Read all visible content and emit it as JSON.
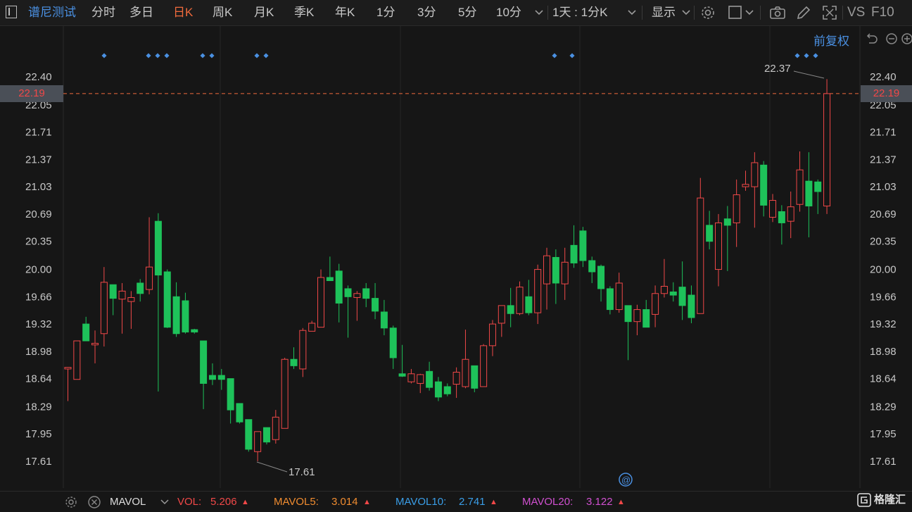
{
  "toolbar": {
    "stock_name": "谱尼测试",
    "tabs": [
      "分时",
      "多日",
      "日K",
      "周K",
      "月K",
      "季K",
      "年K",
      "1分",
      "3分",
      "5分",
      "10分"
    ],
    "active_tab": "日K",
    "period_select": "1天 : 1分K",
    "display_label": "显示",
    "vs_label": "VS",
    "f10_label": "F10"
  },
  "chart": {
    "adjust_label": "前复权",
    "y_ticks": [
      "22.40",
      "22.05",
      "21.71",
      "21.37",
      "21.03",
      "20.69",
      "20.35",
      "20.00",
      "19.66",
      "19.32",
      "18.98",
      "18.64",
      "18.29",
      "17.95",
      "17.61"
    ],
    "current_price": "22.19",
    "high_label": "22.37",
    "low_label": "17.61",
    "colors": {
      "up": "#f04848",
      "down": "#1ec25a",
      "bg": "#161616",
      "grid": "#2a2a2a",
      "marker": "#4a90e2"
    }
  },
  "chart_data": {
    "type": "candlestick",
    "ylim": [
      17.4,
      22.6
    ],
    "candles": [
      {
        "o": 18.76,
        "c": 18.78,
        "h": 18.78,
        "l": 18.36
      },
      {
        "o": 18.63,
        "c": 19.11,
        "h": 19.11,
        "l": 18.63
      },
      {
        "o": 19.32,
        "c": 19.11,
        "h": 19.41,
        "l": 19.11
      },
      {
        "o": 19.06,
        "c": 19.08,
        "h": 19.24,
        "l": 18.83
      },
      {
        "o": 19.2,
        "c": 19.84,
        "h": 20.03,
        "l": 19.04
      },
      {
        "o": 19.81,
        "c": 19.64,
        "h": 19.81,
        "l": 19.43
      },
      {
        "o": 19.63,
        "c": 19.73,
        "h": 19.83,
        "l": 19.2
      },
      {
        "o": 19.6,
        "c": 19.65,
        "h": 19.73,
        "l": 19.26
      },
      {
        "o": 19.83,
        "c": 19.7,
        "h": 19.88,
        "l": 19.6
      },
      {
        "o": 19.75,
        "c": 20.03,
        "h": 20.65,
        "l": 19.69
      },
      {
        "o": 20.6,
        "c": 19.93,
        "h": 20.7,
        "l": 18.48
      },
      {
        "o": 19.97,
        "c": 19.28,
        "h": 20.0,
        "l": 19.27
      },
      {
        "o": 19.66,
        "c": 19.2,
        "h": 19.84,
        "l": 19.16
      },
      {
        "o": 19.61,
        "c": 19.22,
        "h": 19.71,
        "l": 19.2
      },
      {
        "o": 19.25,
        "c": 19.22,
        "h": 19.26,
        "l": 19.2
      },
      {
        "o": 19.11,
        "c": 18.58,
        "h": 19.11,
        "l": 18.26
      },
      {
        "o": 18.68,
        "c": 18.63,
        "h": 18.83,
        "l": 18.56
      },
      {
        "o": 18.68,
        "c": 18.63,
        "h": 18.76,
        "l": 18.5
      },
      {
        "o": 18.64,
        "c": 18.25,
        "h": 18.64,
        "l": 18.08
      },
      {
        "o": 18.33,
        "c": 18.1,
        "h": 18.33,
        "l": 18.08
      },
      {
        "o": 18.13,
        "c": 17.76,
        "h": 18.13,
        "l": 17.73
      },
      {
        "o": 17.73,
        "c": 17.98,
        "h": 17.98,
        "l": 17.61
      },
      {
        "o": 18.03,
        "c": 17.85,
        "h": 18.03,
        "l": 17.82
      },
      {
        "o": 17.88,
        "c": 18.16,
        "h": 18.25,
        "l": 17.83
      },
      {
        "o": 18.02,
        "c": 18.88,
        "h": 18.9,
        "l": 18.02
      },
      {
        "o": 18.88,
        "c": 18.8,
        "h": 19.03,
        "l": 18.76
      },
      {
        "o": 18.76,
        "c": 19.24,
        "h": 19.27,
        "l": 18.66
      },
      {
        "o": 19.23,
        "c": 19.33,
        "h": 19.36,
        "l": 19.24
      },
      {
        "o": 19.28,
        "c": 19.9,
        "h": 20.0,
        "l": 19.28
      },
      {
        "o": 19.9,
        "c": 19.86,
        "h": 20.16,
        "l": 19.86
      },
      {
        "o": 19.98,
        "c": 19.58,
        "h": 20.07,
        "l": 19.34
      },
      {
        "o": 19.76,
        "c": 19.66,
        "h": 19.8,
        "l": 19.15
      },
      {
        "o": 19.65,
        "c": 19.7,
        "h": 19.73,
        "l": 19.36
      },
      {
        "o": 19.76,
        "c": 19.64,
        "h": 19.83,
        "l": 19.53
      },
      {
        "o": 19.64,
        "c": 19.48,
        "h": 19.83,
        "l": 19.38
      },
      {
        "o": 19.47,
        "c": 19.27,
        "h": 19.62,
        "l": 19.18
      },
      {
        "o": 19.27,
        "c": 18.9,
        "h": 19.3,
        "l": 18.76
      },
      {
        "o": 18.7,
        "c": 18.67,
        "h": 19.06,
        "l": 18.66
      },
      {
        "o": 18.6,
        "c": 18.7,
        "h": 18.76,
        "l": 18.58
      },
      {
        "o": 18.58,
        "c": 18.69,
        "h": 18.7,
        "l": 18.46
      },
      {
        "o": 18.73,
        "c": 18.53,
        "h": 18.85,
        "l": 18.49
      },
      {
        "o": 18.6,
        "c": 18.41,
        "h": 18.66,
        "l": 18.36
      },
      {
        "o": 18.54,
        "c": 18.45,
        "h": 18.58,
        "l": 18.42
      },
      {
        "o": 18.57,
        "c": 18.72,
        "h": 18.78,
        "l": 18.4
      },
      {
        "o": 18.54,
        "c": 18.88,
        "h": 19.25,
        "l": 18.52
      },
      {
        "o": 18.8,
        "c": 18.52,
        "h": 18.8,
        "l": 18.47
      },
      {
        "o": 18.54,
        "c": 19.05,
        "h": 19.07,
        "l": 18.54
      },
      {
        "o": 19.05,
        "c": 19.32,
        "h": 19.37,
        "l": 18.92
      },
      {
        "o": 19.33,
        "c": 19.55,
        "h": 19.55,
        "l": 19.16
      },
      {
        "o": 19.55,
        "c": 19.45,
        "h": 19.77,
        "l": 19.28
      },
      {
        "o": 19.45,
        "c": 19.78,
        "h": 19.85,
        "l": 19.43
      },
      {
        "o": 19.66,
        "c": 19.46,
        "h": 19.87,
        "l": 19.43
      },
      {
        "o": 19.46,
        "c": 20.0,
        "h": 20.06,
        "l": 19.32
      },
      {
        "o": 19.82,
        "c": 20.17,
        "h": 20.27,
        "l": 19.5
      },
      {
        "o": 20.15,
        "c": 19.83,
        "h": 20.25,
        "l": 19.57
      },
      {
        "o": 19.82,
        "c": 20.09,
        "h": 20.27,
        "l": 19.62
      },
      {
        "o": 20.3,
        "c": 20.08,
        "h": 20.55,
        "l": 20.02
      },
      {
        "o": 20.48,
        "c": 20.11,
        "h": 20.53,
        "l": 20.03
      },
      {
        "o": 20.11,
        "c": 19.97,
        "h": 20.16,
        "l": 19.83
      },
      {
        "o": 20.04,
        "c": 19.76,
        "h": 20.06,
        "l": 19.6
      },
      {
        "o": 19.76,
        "c": 19.5,
        "h": 19.79,
        "l": 19.44
      },
      {
        "o": 19.5,
        "c": 19.83,
        "h": 19.96,
        "l": 19.46
      },
      {
        "o": 19.55,
        "c": 19.35,
        "h": 19.55,
        "l": 18.87
      },
      {
        "o": 19.35,
        "c": 19.5,
        "h": 19.56,
        "l": 19.18
      },
      {
        "o": 19.5,
        "c": 19.28,
        "h": 19.62,
        "l": 19.28
      },
      {
        "o": 19.44,
        "c": 19.7,
        "h": 19.8,
        "l": 19.28
      },
      {
        "o": 19.7,
        "c": 19.79,
        "h": 20.13,
        "l": 19.65
      },
      {
        "o": 19.72,
        "c": 19.68,
        "h": 19.84,
        "l": 19.6
      },
      {
        "o": 19.78,
        "c": 19.55,
        "h": 20.1,
        "l": 19.37
      },
      {
        "o": 19.68,
        "c": 19.4,
        "h": 19.8,
        "l": 19.33
      },
      {
        "o": 19.45,
        "c": 20.89,
        "h": 21.14,
        "l": 19.45
      },
      {
        "o": 20.55,
        "c": 20.35,
        "h": 20.73,
        "l": 20.25
      },
      {
        "o": 20.0,
        "c": 20.58,
        "h": 20.69,
        "l": 19.79
      },
      {
        "o": 20.63,
        "c": 20.55,
        "h": 20.79,
        "l": 19.98
      },
      {
        "o": 20.58,
        "c": 20.93,
        "h": 21.12,
        "l": 20.28
      },
      {
        "o": 21.03,
        "c": 21.06,
        "h": 21.23,
        "l": 20.98
      },
      {
        "o": 21.03,
        "c": 21.33,
        "h": 21.46,
        "l": 20.52
      },
      {
        "o": 21.3,
        "c": 20.8,
        "h": 21.35,
        "l": 20.66
      },
      {
        "o": 20.65,
        "c": 20.86,
        "h": 20.94,
        "l": 20.59
      },
      {
        "o": 20.72,
        "c": 20.58,
        "h": 20.8,
        "l": 20.31
      },
      {
        "o": 20.6,
        "c": 20.78,
        "h": 20.97,
        "l": 20.39
      },
      {
        "o": 20.81,
        "c": 21.24,
        "h": 21.47,
        "l": 20.72
      },
      {
        "o": 21.1,
        "c": 20.79,
        "h": 21.46,
        "l": 20.4
      },
      {
        "o": 21.09,
        "c": 20.97,
        "h": 21.12,
        "l": 20.69
      },
      {
        "o": 20.79,
        "c": 22.19,
        "h": 22.37,
        "l": 20.69
      }
    ],
    "event_markers_x": [
      148,
      211,
      224,
      237,
      288,
      301,
      365,
      378,
      788,
      813,
      1133,
      1146,
      1159
    ]
  },
  "bottom": {
    "mavol_label": "MAVOL",
    "vol_label": "VOL:",
    "vol_value": "5.206",
    "mavol5_label": "MAVOL5:",
    "mavol5_value": "3.014",
    "mavol10_label": "MAVOL10:",
    "mavol10_value": "2.741",
    "mavol20_label": "MAVOL20:",
    "mavol20_value": "3.122",
    "brand": "格隆汇"
  }
}
